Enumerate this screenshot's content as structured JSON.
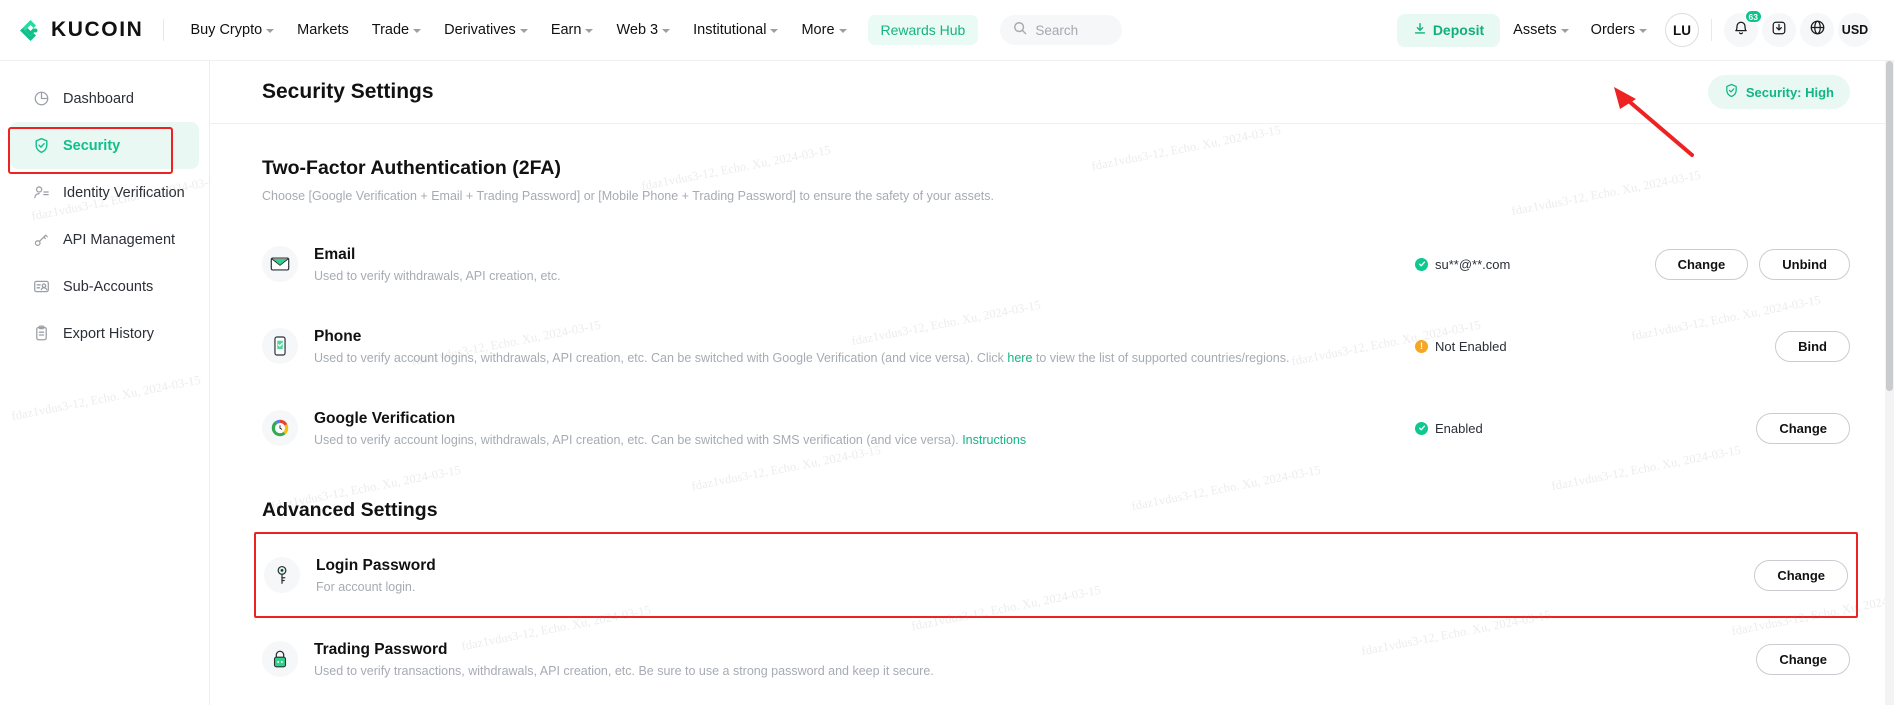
{
  "brand": {
    "name": "KUCOIN",
    "accent": "#0fc08a"
  },
  "topnav": {
    "items": [
      {
        "label": "Buy Crypto",
        "caret": true
      },
      {
        "label": "Markets",
        "caret": false
      },
      {
        "label": "Trade",
        "caret": true
      },
      {
        "label": "Derivatives",
        "caret": true
      },
      {
        "label": "Earn",
        "caret": true
      },
      {
        "label": "Web 3",
        "caret": true
      },
      {
        "label": "Institutional",
        "caret": true
      },
      {
        "label": "More",
        "caret": true
      }
    ],
    "rewards_hub": "Rewards Hub",
    "search_placeholder": "Search",
    "deposit_label": "Deposit",
    "right_items": [
      {
        "label": "Assets",
        "caret": true
      },
      {
        "label": "Orders",
        "caret": true
      }
    ],
    "avatar_initials": "LU",
    "notification_badge": "63",
    "currency": "USD"
  },
  "sidebar": {
    "items": [
      {
        "label": "Dashboard",
        "icon": "pie-chart-icon",
        "active": false
      },
      {
        "label": "Security",
        "icon": "shield-check-icon",
        "active": true
      },
      {
        "label": "Identity Verification",
        "icon": "user-id-icon",
        "active": false
      },
      {
        "label": "API Management",
        "icon": "key-link-icon",
        "active": false
      },
      {
        "label": "Sub-Accounts",
        "icon": "accounts-card-icon",
        "active": false
      },
      {
        "label": "Export History",
        "icon": "clipboard-icon",
        "active": false
      }
    ]
  },
  "page": {
    "title": "Security Settings",
    "security_badge": "Security: High"
  },
  "twofa": {
    "title": "Two-Factor Authentication (2FA)",
    "subtitle": "Choose [Google Verification + Email + Trading Password] or [Mobile Phone + Trading Password] to ensure the safety of your assets.",
    "rows": [
      {
        "name": "Email",
        "icon": "email-icon",
        "desc_before": "Used to verify withdrawals, API creation, etc.",
        "link_text": "",
        "desc_after": "",
        "status": "su**@**.com",
        "status_type": "ok",
        "buttons": [
          "Change",
          "Unbind"
        ]
      },
      {
        "name": "Phone",
        "icon": "phone-icon",
        "desc_before": "Used to verify account logins, withdrawals, API creation, etc. Can be switched with Google Verification (and vice versa). Click ",
        "link_text": "here",
        "desc_after": " to view the list of supported countries/regions.",
        "status": "Not Enabled",
        "status_type": "warn",
        "buttons": [
          "Bind"
        ]
      },
      {
        "name": "Google Verification",
        "icon": "google-authenticator-icon",
        "desc_before": "Used to verify account logins, withdrawals, API creation, etc. Can be switched with SMS verification (and vice versa). ",
        "link_text": "Instructions",
        "desc_after": "",
        "status": "Enabled",
        "status_type": "ok",
        "buttons": [
          "Change"
        ]
      }
    ]
  },
  "advanced": {
    "title": "Advanced Settings",
    "rows": [
      {
        "name": "Login Password",
        "icon": "key-icon",
        "desc_before": "For account login.",
        "link_text": "",
        "desc_after": "",
        "status": "",
        "status_type": "none",
        "buttons": [
          "Change"
        ],
        "highlighted": true
      },
      {
        "name": "Trading Password",
        "icon": "lock-icon",
        "desc_before": "Used to verify transactions, withdrawals, API creation, etc. Be sure to use a strong password and keep it secure.",
        "link_text": "",
        "desc_after": "",
        "status": "",
        "status_type": "none",
        "buttons": [
          "Change"
        ],
        "highlighted": false
      }
    ]
  },
  "watermark": {
    "text": "fdaz1vdus3-12, Echo. Xu, 2024-03-15"
  }
}
